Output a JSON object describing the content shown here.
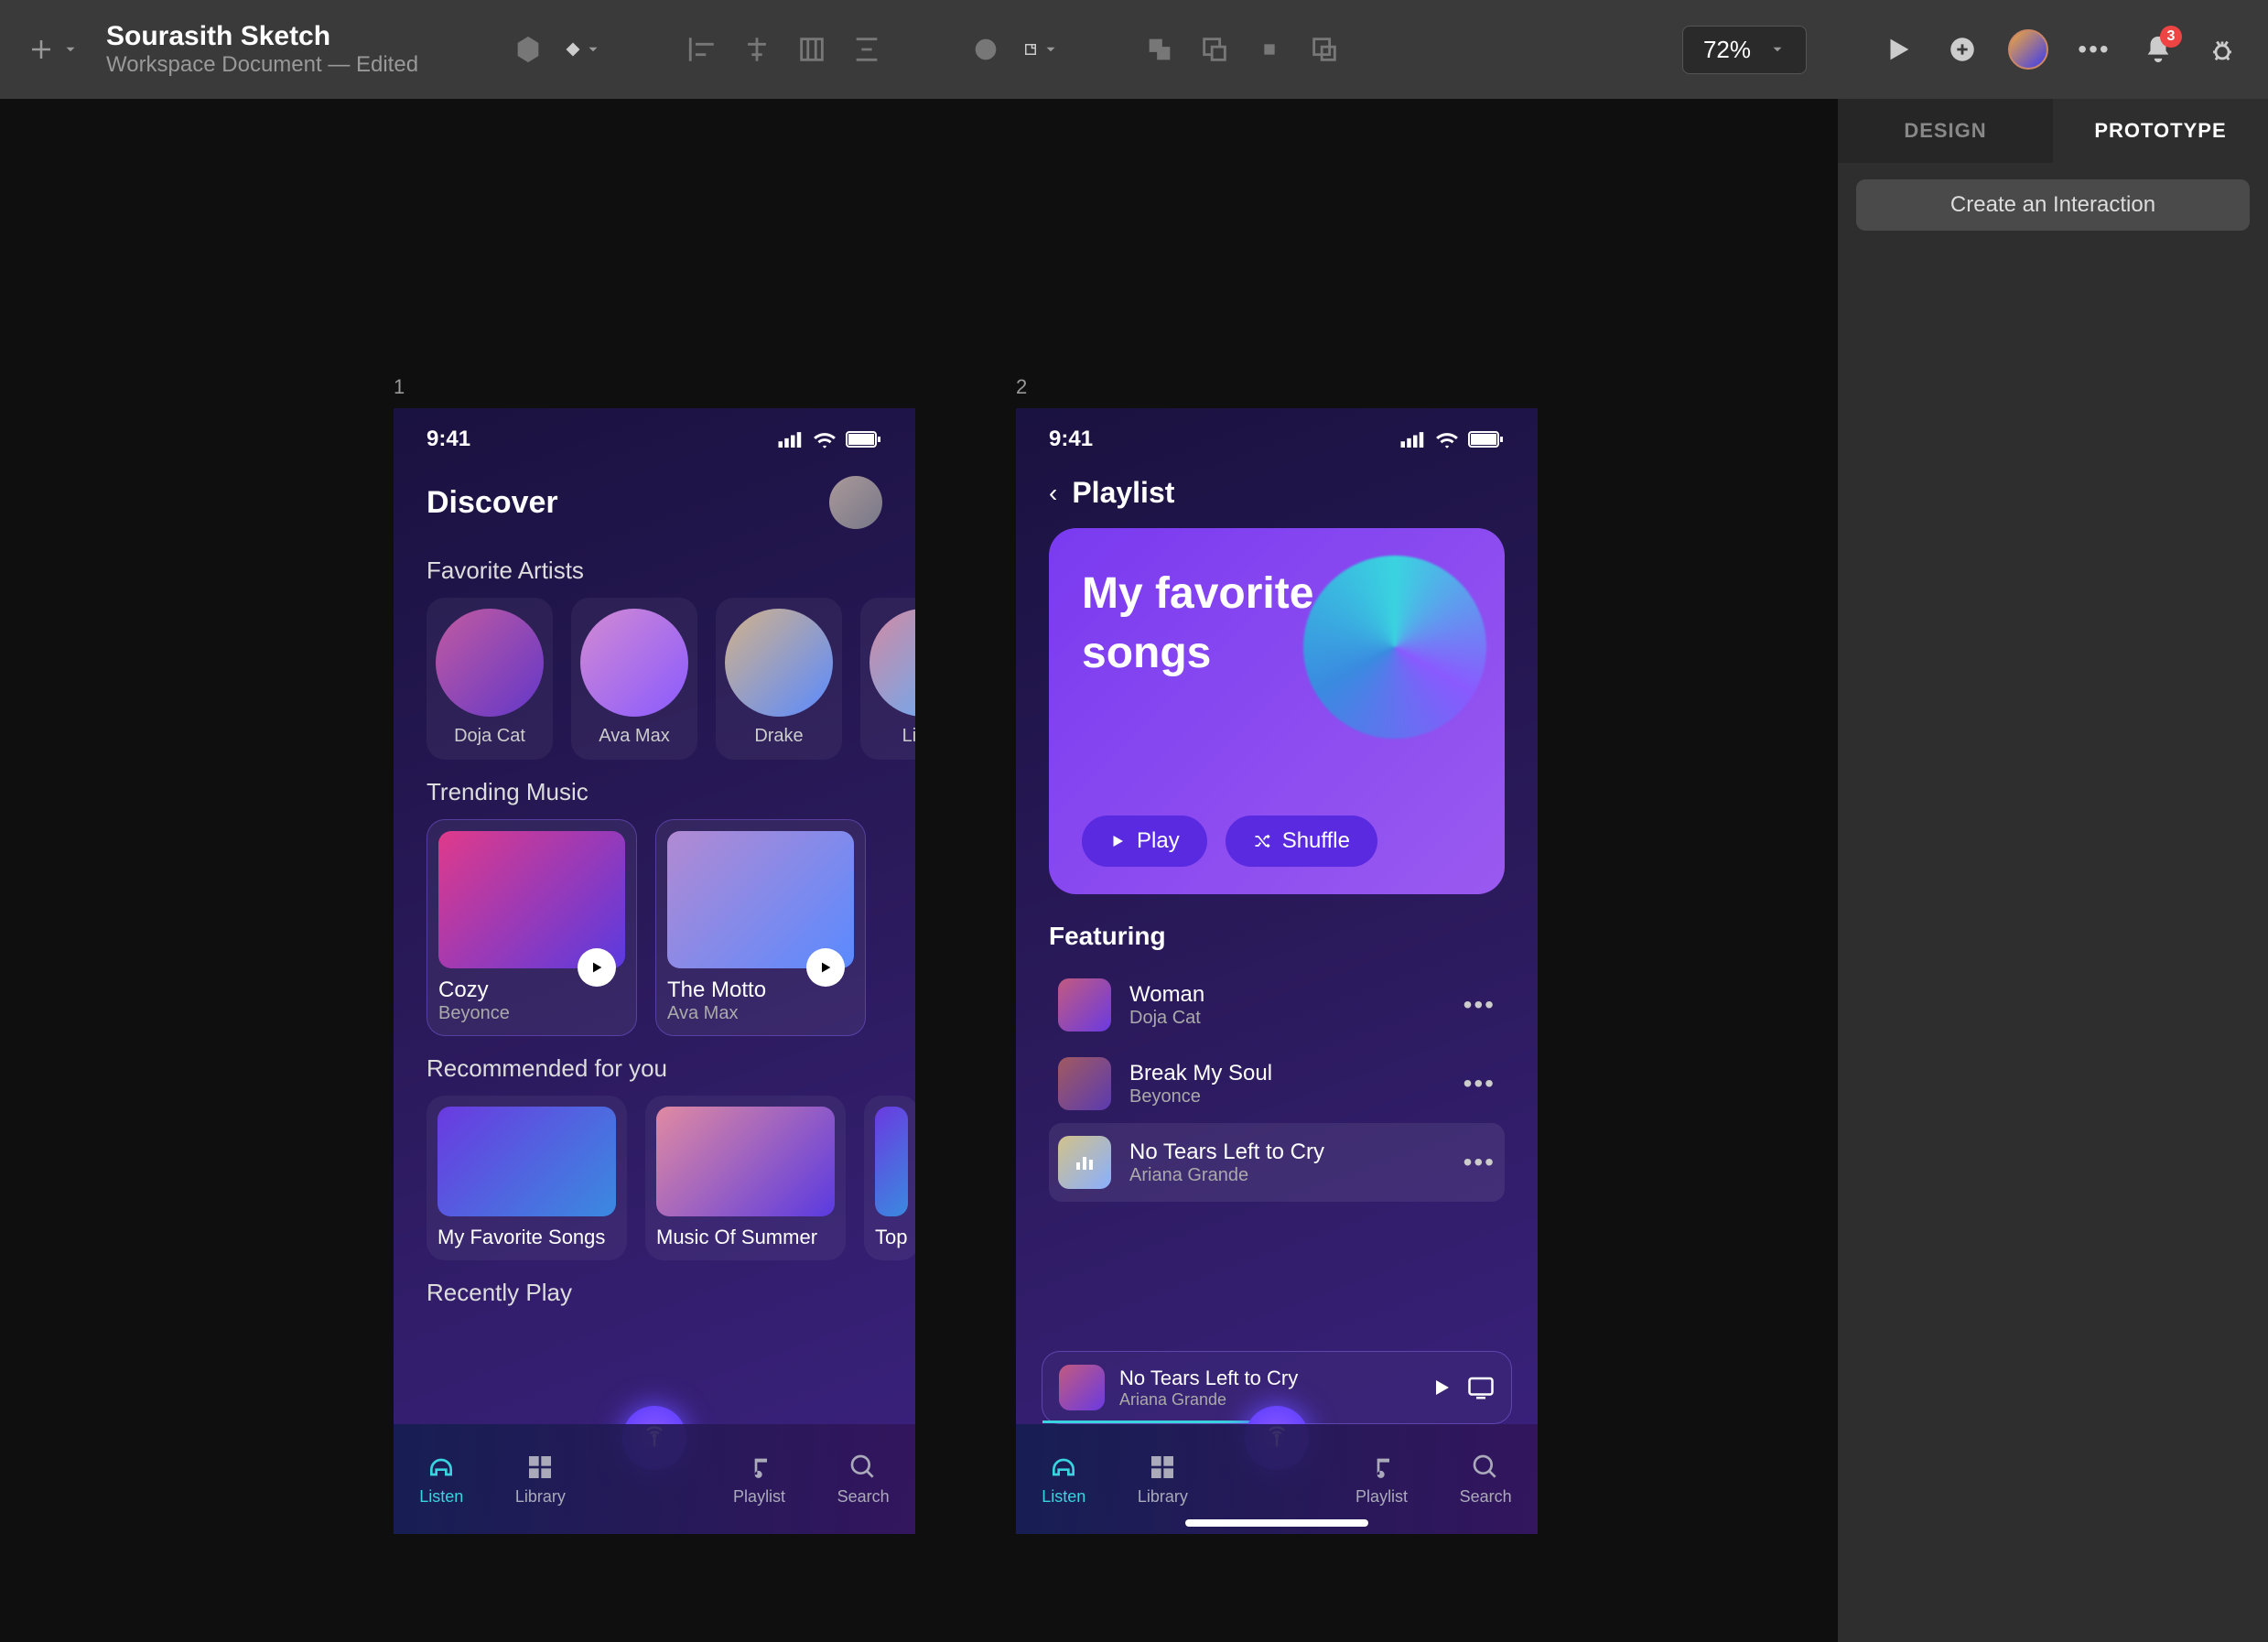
{
  "header": {
    "doc_title": "Sourasith Sketch",
    "doc_subtitle": "Workspace Document — Edited",
    "zoom": "72%",
    "notification_count": "3"
  },
  "right_panel": {
    "tab_design": "DESIGN",
    "tab_prototype": "PROTOTYPE",
    "create_button": "Create an Interaction"
  },
  "artboard_labels": {
    "ab1": "1",
    "ab2": "2"
  },
  "screen1": {
    "time": "9:41",
    "title": "Discover",
    "fav_label": "Favorite Artists",
    "artists": [
      {
        "name": "Doja Cat"
      },
      {
        "name": "Ava Max"
      },
      {
        "name": "Drake"
      },
      {
        "name": "Lizzo"
      }
    ],
    "trend_label": "Trending Music",
    "trending": [
      {
        "title": "Cozy",
        "artist": "Beyonce"
      },
      {
        "title": "The Motto",
        "artist": "Ava Max"
      }
    ],
    "rec_label": "Recommended for you",
    "recs": [
      {
        "title": "My Favorite Songs"
      },
      {
        "title": "Music Of Summer"
      },
      {
        "title": "Top o"
      }
    ],
    "recent_label": "Recently Play",
    "nav": {
      "listen": "Listen",
      "library": "Library",
      "playlist": "Playlist",
      "search": "Search"
    }
  },
  "screen2": {
    "time": "9:41",
    "head": "Playlist",
    "hero_title": "My favorite songs",
    "play_btn": "Play",
    "shuffle_btn": "Shuffle",
    "featuring": "Featuring",
    "tracks": [
      {
        "name": "Woman",
        "artist": "Doja Cat"
      },
      {
        "name": "Break My Soul",
        "artist": "Beyonce"
      },
      {
        "name": "No Tears Left to Cry",
        "artist": "Ariana Grande"
      }
    ],
    "nowplaying": {
      "name": "No Tears Left to Cry",
      "artist": "Ariana Grande"
    },
    "nav": {
      "listen": "Listen",
      "library": "Library",
      "playlist": "Playlist",
      "search": "Search"
    }
  }
}
